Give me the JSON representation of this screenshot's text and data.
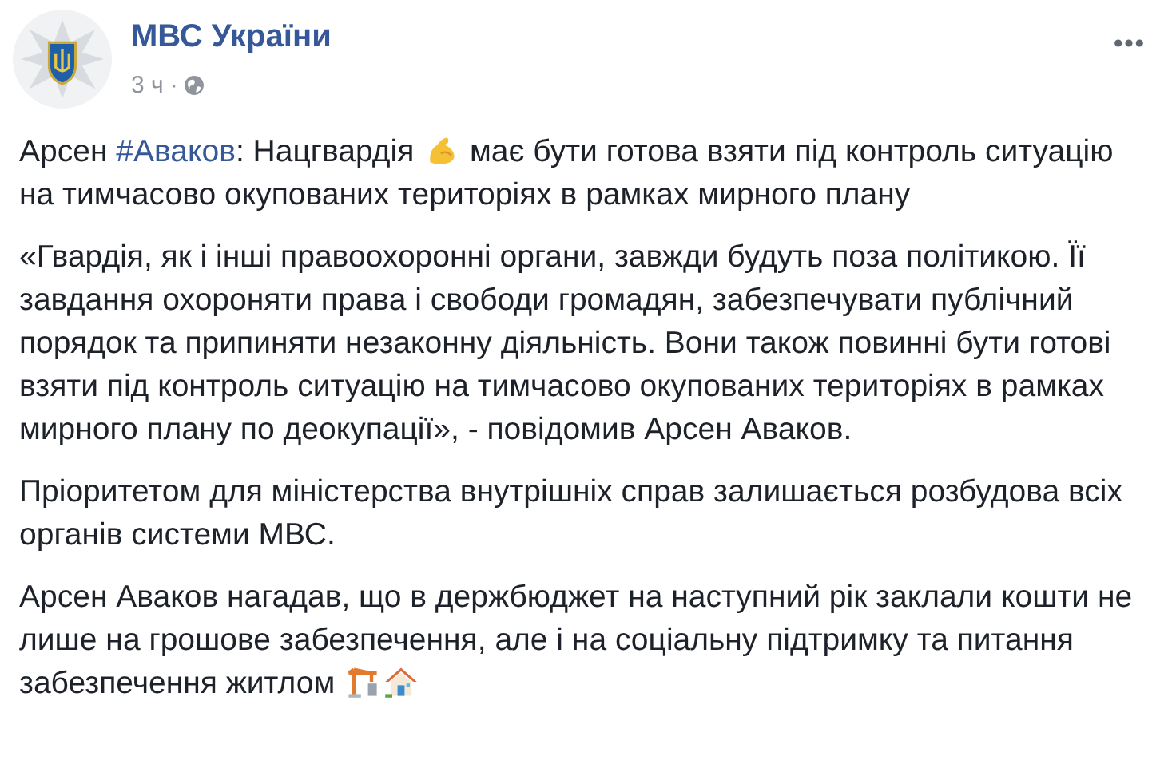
{
  "post": {
    "author": "МВС України",
    "time": "3 ч",
    "separator": "·",
    "paragraphs": [
      {
        "segments": [
          {
            "kind": "text",
            "text": "Арсен "
          },
          {
            "kind": "hashtag",
            "text": "#Аваков"
          },
          {
            "kind": "text",
            "text": ": Нацгвардія "
          },
          {
            "kind": "biceps"
          },
          {
            "kind": "text",
            "text": " має бути готова взяти під контроль ситуацію на тимчасово окупованих територіях в рамках мирного плану"
          }
        ]
      },
      {
        "segments": [
          {
            "kind": "text",
            "text": "«Гвардія, як і інші правоохоронні органи, завжди будуть поза політикою. Її завдання охороняти права і свободи громадян, забезпечувати публічний порядок та припиняти незаконну діяльність. Вони також повинні бути готові взяти під контроль ситуацію на тимчасово окупованих територіях в рамках мирного плану по деокупації», - повідомив Арсен Аваков."
          }
        ]
      },
      {
        "segments": [
          {
            "kind": "text",
            "text": "Пріоритетом для міністерства внутрішніх справ залишається розбудова всіх органів системи МВС."
          }
        ]
      },
      {
        "segments": [
          {
            "kind": "text",
            "text": "Арсен Аваков нагадав, що в держбюджет на наступний рік заклали кошти не лише на грошове забезпечення, але і на соціальну підтримку та питання забезпечення житлом "
          },
          {
            "kind": "crane"
          },
          {
            "kind": "house"
          }
        ]
      }
    ]
  }
}
